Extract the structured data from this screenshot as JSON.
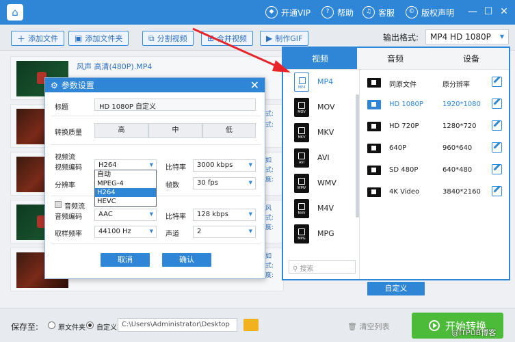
{
  "titlebar": {
    "links": [
      {
        "label": "开通VIP",
        "icon": "vip-icon"
      },
      {
        "label": "帮助",
        "icon": "help-icon"
      },
      {
        "label": "客服",
        "icon": "headset-icon"
      },
      {
        "label": "版权声明",
        "icon": "copyright-icon"
      }
    ]
  },
  "toolbar": {
    "add_file": "添加文件",
    "add_folder": "添加文件夹",
    "split_video": "分割视频",
    "merge_video": "合并视频",
    "make_gif": "制作GIF",
    "output_format_label": "输出格式:",
    "output_format_value": "MP4  HD 1080P"
  },
  "files": [
    {
      "name": "风声 高清(480P).MP4"
    },
    {
      "side1": "式:",
      "side2": "式:"
    },
    {
      "side0": "如",
      "side1": "式:",
      "side2": "度:"
    },
    {
      "side0": "风",
      "side1": "式:",
      "side2": "度:"
    },
    {
      "side0": "如",
      "side1": "式:",
      "side2": "度:"
    }
  ],
  "dialog": {
    "title": "参数设置",
    "title_label": "标题",
    "title_value": "HD 1080P 自定义",
    "quality_label": "转换质量",
    "quality_options": [
      "高",
      "中",
      "低"
    ],
    "video_stream": "视频流",
    "video_codec_label": "视频编码",
    "video_codec_value": "H264",
    "bitrate_label": "比特率",
    "bitrate_value": "3000 kbps",
    "resolution_label": "分辨率",
    "fps_label": "帧数",
    "fps_value": "30 fps",
    "codec_options": [
      "自动",
      "MPEG-4",
      "H264",
      "HEVC"
    ],
    "audio_stream": "音频流",
    "audio_codec_label": "音频编码",
    "audio_codec_value": "AAC",
    "audio_bitrate_label": "比特率",
    "audio_bitrate_value": "128 kbps",
    "sample_rate_label": "取样频率",
    "sample_rate_value": "44100 Hz",
    "channel_label": "声道",
    "channel_value": "2",
    "cancel": "取消",
    "confirm": "确认"
  },
  "format_panel": {
    "tabs": [
      "视频",
      "音频",
      "设备"
    ],
    "formats": [
      "MP4",
      "MOV",
      "MKV",
      "AVI",
      "WMV",
      "M4V",
      "MPG"
    ],
    "search_placeholder": "搜索",
    "resolutions": [
      {
        "name": "同原文件",
        "size": "原分辨率"
      },
      {
        "name": "HD 1080P",
        "size": "1920*1080"
      },
      {
        "name": "HD 720P",
        "size": "1280*720"
      },
      {
        "name": "640P",
        "size": "960*640"
      },
      {
        "name": "SD 480P",
        "size": "640*480"
      },
      {
        "name": "4K Video",
        "size": "3840*2160"
      }
    ],
    "custom": "自定义"
  },
  "bottom": {
    "save_to": "保存至:",
    "original_folder": "原文件夹",
    "custom": "自定义",
    "path": "C:\\Users\\Administrator\\Desktop",
    "clear_list": "清空列表",
    "start": "开始转换"
  },
  "watermark": "@ITPUB博客",
  "colors": {
    "accent": "#2f86d6",
    "start": "#4dbb3a",
    "arrow": "#e8242b"
  }
}
